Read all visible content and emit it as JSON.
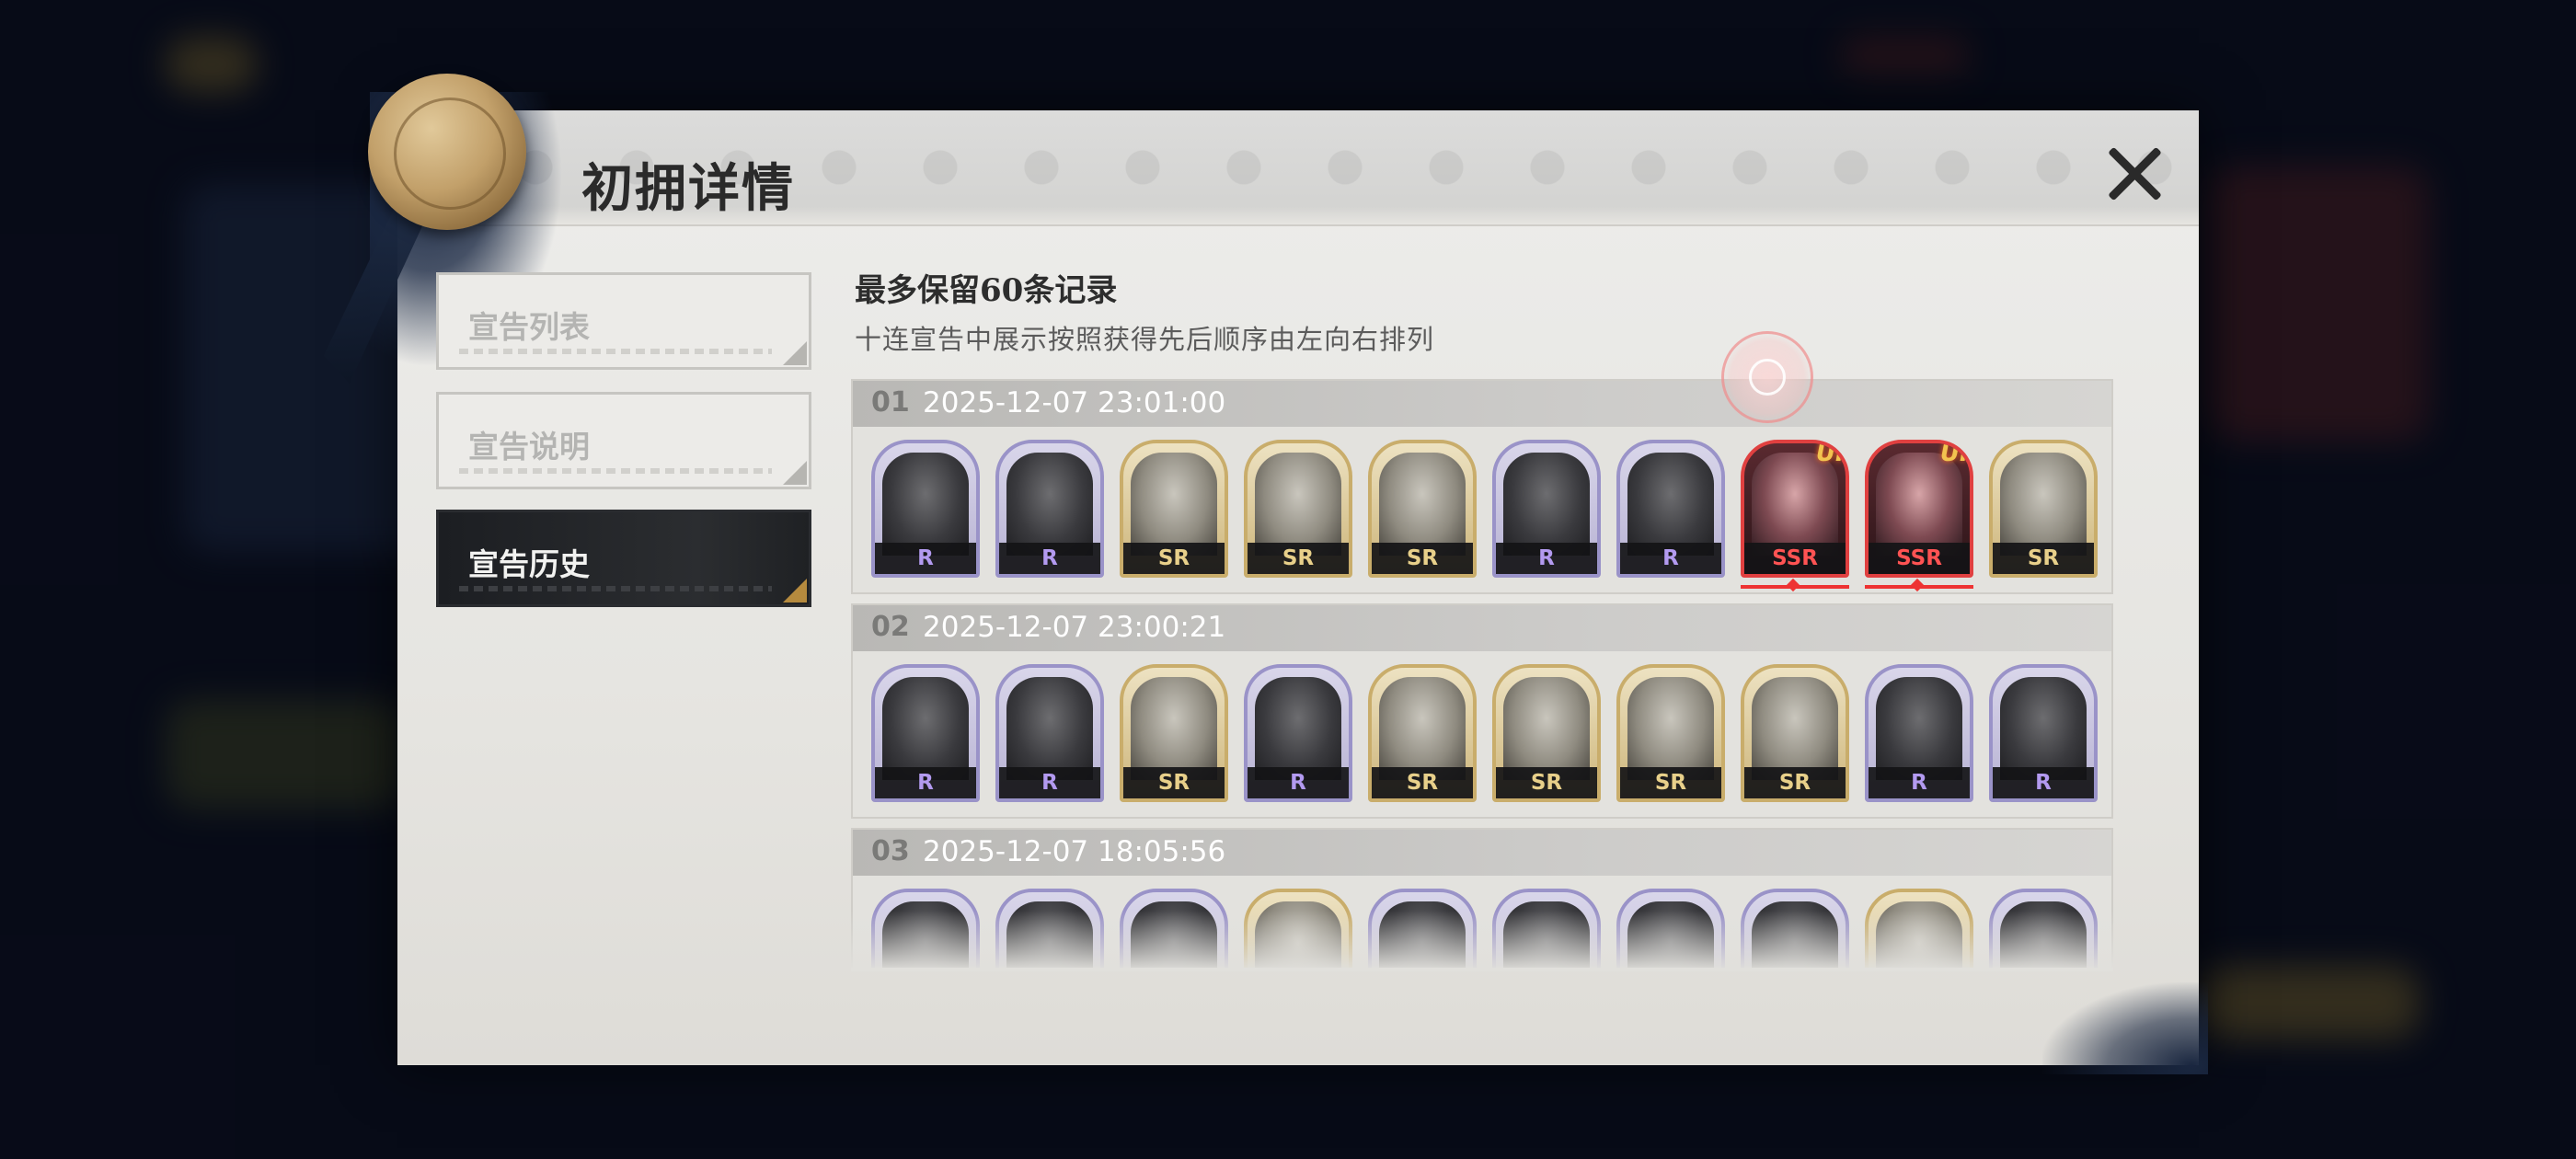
{
  "modal": {
    "title": "初拥详情",
    "close_label": "×"
  },
  "tabs": [
    {
      "label": "宣告列表",
      "active": false
    },
    {
      "label": "宣告说明",
      "active": false
    },
    {
      "label": "宣告历史",
      "active": true
    }
  ],
  "notice": {
    "title": "最多保留60条记录",
    "description": "十连宣告中展示按照获得先后顺序由左向右排列"
  },
  "records": [
    {
      "index": "01",
      "time": "2025-12-07 23:01:00",
      "cards": [
        {
          "rarity": "R"
        },
        {
          "rarity": "R"
        },
        {
          "rarity": "SR"
        },
        {
          "rarity": "SR"
        },
        {
          "rarity": "SR"
        },
        {
          "rarity": "R"
        },
        {
          "rarity": "R"
        },
        {
          "rarity": "SSR",
          "badge": "UP"
        },
        {
          "rarity": "SSR",
          "badge": "UP"
        },
        {
          "rarity": "SR"
        }
      ]
    },
    {
      "index": "02",
      "time": "2025-12-07 23:00:21",
      "cards": [
        {
          "rarity": "R"
        },
        {
          "rarity": "R"
        },
        {
          "rarity": "SR"
        },
        {
          "rarity": "R"
        },
        {
          "rarity": "SR"
        },
        {
          "rarity": "SR"
        },
        {
          "rarity": "SR"
        },
        {
          "rarity": "SR"
        },
        {
          "rarity": "R"
        },
        {
          "rarity": "R"
        }
      ]
    },
    {
      "index": "03",
      "time": "2025-12-07 18:05:56",
      "cards": [
        {
          "rarity": "R"
        },
        {
          "rarity": "R"
        },
        {
          "rarity": "R"
        },
        {
          "rarity": "SR"
        },
        {
          "rarity": "R"
        },
        {
          "rarity": "R"
        },
        {
          "rarity": "R"
        },
        {
          "rarity": "R"
        },
        {
          "rarity": "SR"
        },
        {
          "rarity": "R"
        }
      ]
    }
  ],
  "colors": {
    "r_frame": "#9a93c8",
    "sr_frame": "#c9ad6b",
    "ssr_frame": "#e04040",
    "active_tab": "#1c1e22"
  }
}
